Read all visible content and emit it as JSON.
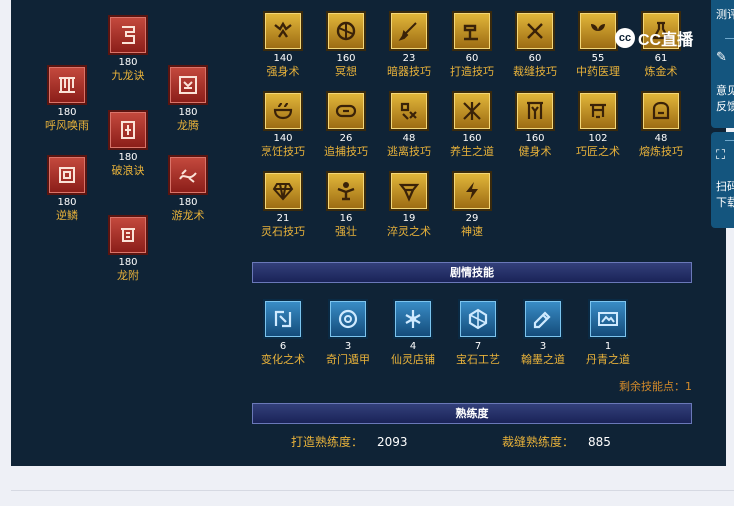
{
  "red_skills": [
    {
      "num": "180",
      "name": "九龙诀",
      "icon": "dragon-coil-icon"
    },
    {
      "num": "180",
      "name": "呼风唤雨",
      "icon": "rain-icon"
    },
    {
      "num": "180",
      "name": "龙腾",
      "icon": "dragon-rise-icon"
    },
    {
      "num": "180",
      "name": "破浪诀",
      "icon": "wave-icon"
    },
    {
      "num": "180",
      "name": "逆鳞",
      "icon": "scale-icon"
    },
    {
      "num": "180",
      "name": "游龙术",
      "icon": "dragon-swim-icon"
    },
    {
      "num": "180",
      "name": "龙附",
      "icon": "dragon-attach-icon"
    }
  ],
  "gold_skills": [
    {
      "num": "140",
      "name": "强身术",
      "icon": "strength-icon"
    },
    {
      "num": "160",
      "name": "冥想",
      "icon": "meditate-icon"
    },
    {
      "num": "23",
      "name": "暗器技巧",
      "icon": "dart-icon"
    },
    {
      "num": "60",
      "name": "打造技巧",
      "icon": "hammer-icon"
    },
    {
      "num": "60",
      "name": "裁缝技巧",
      "icon": "scissors-icon"
    },
    {
      "num": "55",
      "name": "中药医理",
      "icon": "herb-icon"
    },
    {
      "num": "61",
      "name": "炼金术",
      "icon": "alchemy-icon"
    },
    {
      "num": "140",
      "name": "烹饪技巧",
      "icon": "cooking-icon"
    },
    {
      "num": "26",
      "name": "追捕技巧",
      "icon": "chase-icon"
    },
    {
      "num": "48",
      "name": "逃离技巧",
      "icon": "escape-icon"
    },
    {
      "num": "160",
      "name": "养生之道",
      "icon": "health-icon"
    },
    {
      "num": "160",
      "name": "健身术",
      "icon": "fitness-icon"
    },
    {
      "num": "102",
      "name": "巧匠之术",
      "icon": "craftsman-icon"
    },
    {
      "num": "48",
      "name": "熔炼技巧",
      "icon": "smelt-icon"
    },
    {
      "num": "21",
      "name": "灵石技巧",
      "icon": "gem-icon"
    },
    {
      "num": "16",
      "name": "强壮",
      "icon": "muscle-icon"
    },
    {
      "num": "19",
      "name": "淬灵之术",
      "icon": "vortex-icon"
    },
    {
      "num": "29",
      "name": "神速",
      "icon": "speed-icon"
    }
  ],
  "plot_section_title": "剧情技能",
  "blue_skills": [
    {
      "num": "6",
      "name": "变化之术",
      "icon": "transform-icon"
    },
    {
      "num": "3",
      "name": "奇门遁甲",
      "icon": "formation-icon"
    },
    {
      "num": "4",
      "name": "仙灵店铺",
      "icon": "shop-icon"
    },
    {
      "num": "7",
      "name": "宝石工艺",
      "icon": "jewel-icon"
    },
    {
      "num": "3",
      "name": "翰墨之道",
      "icon": "ink-icon"
    },
    {
      "num": "1",
      "name": "丹青之道",
      "icon": "painting-icon"
    }
  ],
  "remaining_points": "剩余技能点：1",
  "proficiency_section_title": "熟练度",
  "proficiency": [
    {
      "label": "打造熟练度：",
      "value": "2093"
    },
    {
      "label": "裁缝熟练度：",
      "value": "885"
    }
  ],
  "overlay": {
    "logo_text": "CC直播",
    "logo_mark": "cc"
  },
  "sidebar": {
    "item1": "测评",
    "item2": "意见",
    "item3": "反馈",
    "item4": "扫码",
    "item5": "下载"
  },
  "colors": {
    "panel": "#0f2336",
    "gold_text": "#e8b23a",
    "accent_orange": "#d38a2a",
    "section_bar": "#26306a"
  }
}
